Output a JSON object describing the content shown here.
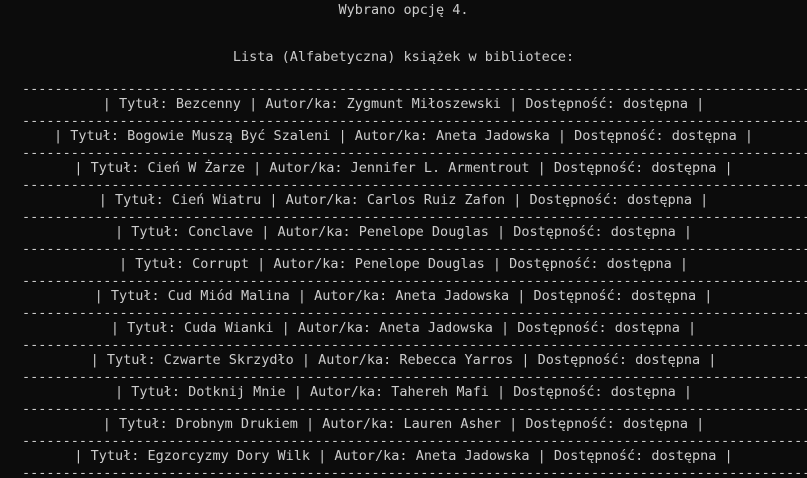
{
  "console": {
    "selected_option": "Wybrano opcję 4.",
    "list_header": "Lista (Alfabetyczna) książek w bibliotece:",
    "separator": "------------------------------------------------------------------------------------------------------------------------------------",
    "rows": [
      "| Tytuł: Bezcenny | Autor/ka: Zygmunt Miłoszewski | Dostępność: dostępna |",
      "| Tytuł: Bogowie Muszą Być Szaleni | Autor/ka: Aneta Jadowska | Dostępność: dostępna |",
      "| Tytuł: Cień W Żarze | Autor/ka: Jennifer L. Armentrout | Dostępność: dostępna |",
      "| Tytuł: Cień Wiatru | Autor/ka: Carlos Ruiz Zafon | Dostępność: dostępna |",
      "| Tytuł: Conclave | Autor/ka: Penelope Douglas | Dostępność: dostępna |",
      "| Tytuł: Corrupt | Autor/ka: Penelope Douglas | Dostępność: dostępna |",
      "| Tytuł: Cud Miód Malina | Autor/ka: Aneta Jadowska | Dostępność: dostępna |",
      "| Tytuł: Cuda Wianki | Autor/ka: Aneta Jadowska | Dostępność: dostępna |",
      "| Tytuł: Czwarte Skrzydło | Autor/ka: Rebecca Yarros | Dostępność: dostępna |",
      "| Tytuł: Dotknij Mnie | Autor/ka: Tahereh Mafi | Dostępność: dostępna |",
      "| Tytuł: Drobnym Drukiem | Autor/ka: Lauren Asher | Dostępność: dostępna |",
      "| Tytuł: Egzorcyzmy Dory Wilk | Autor/ka: Aneta Jadowska | Dostępność: dostępna |"
    ]
  }
}
